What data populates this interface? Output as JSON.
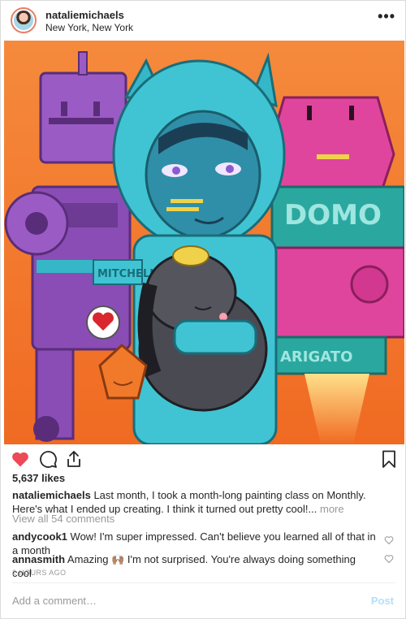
{
  "post": {
    "username": "nataliemichaels",
    "location": "New York, New York",
    "more_label": "•••",
    "likes": "5,637 likes",
    "caption_user": "nataliemichaels",
    "caption_text": "Last month, I took a month-long painting class on Monthly. Here's what I ended up creating. I think it turned out pretty cool!...",
    "caption_more": "more",
    "view_all": "View all 54 comments",
    "comments": [
      {
        "user": "andycook1",
        "text": "Wow! I'm super impressed. Can't believe you learned all of that in a month"
      },
      {
        "user": "annasmith",
        "text": "Amazing 🙌🏽  I'm not surprised. You're always doing something cool"
      }
    ],
    "timestamp": "2 HOURS AGO",
    "add_comment_placeholder": "Add a comment…",
    "post_label": "Post",
    "painting_text": {
      "sign_domo": "DOMO",
      "sign_arigato": "ARIGATO",
      "name_patch": "MITCHELL"
    }
  },
  "icons": {
    "like": "heart-filled-icon",
    "comment": "comment-bubble-icon",
    "share": "share-icon",
    "save": "bookmark-icon"
  },
  "colors": {
    "like_red": "#ed4956",
    "muted_text": "#999999",
    "post_button": "#b2dffc",
    "border": "#dbdbdb"
  }
}
